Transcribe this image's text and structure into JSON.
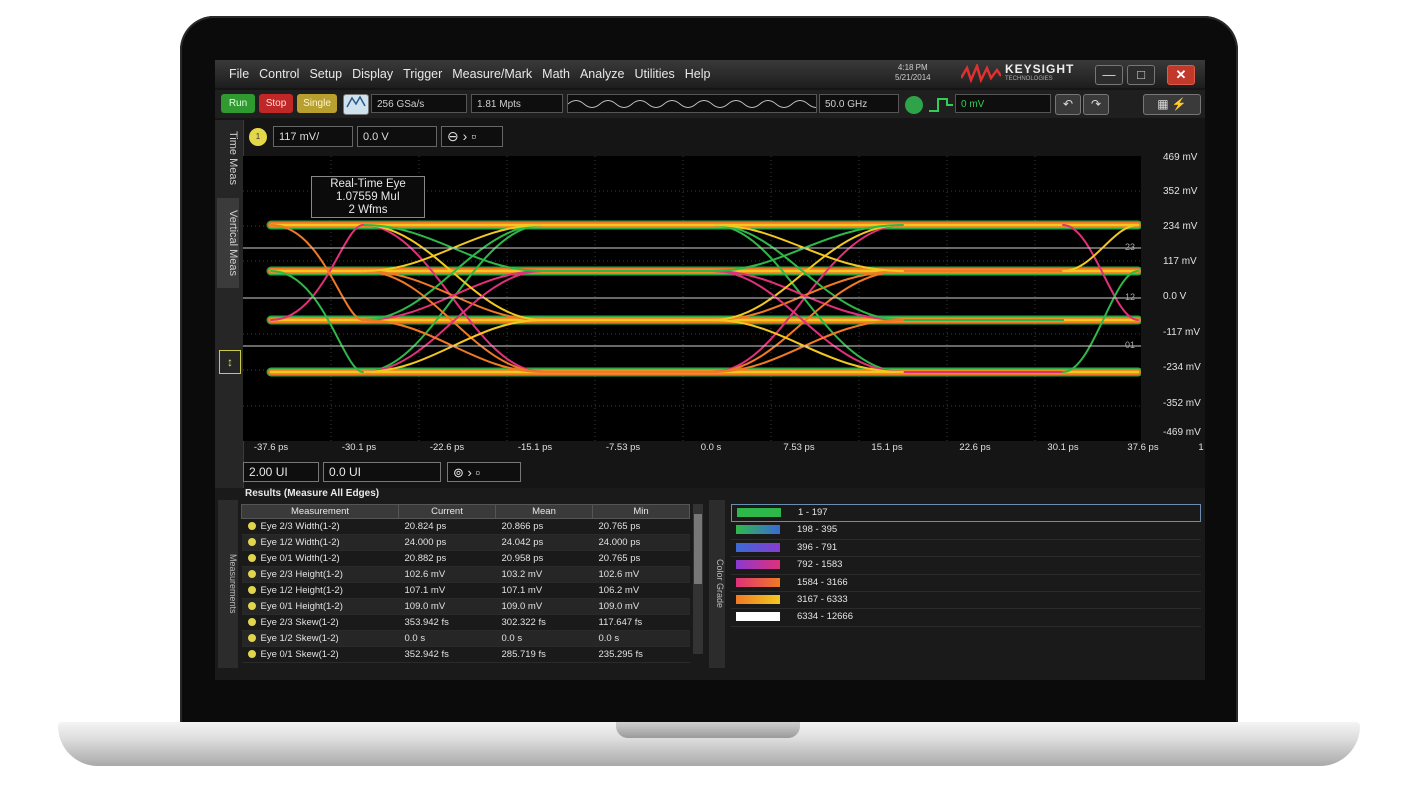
{
  "menu": [
    "File",
    "Control",
    "Setup",
    "Display",
    "Trigger",
    "Measure/Mark",
    "Math",
    "Analyze",
    "Utilities",
    "Help"
  ],
  "datetime": {
    "time": "4:18 PM",
    "date": "5/21/2014"
  },
  "brand": {
    "name": "KEYSIGHT",
    "sub": "TECHNOLOGIES"
  },
  "window_buttons": {
    "minimize": "—",
    "maximize": "□",
    "close": "✕"
  },
  "toolbar": {
    "run": "Run",
    "stop": "Stop",
    "single": "Single",
    "sample_rate": "256 GSa/s",
    "memory_depth": "1.81 Mpts",
    "bandwidth": "50.0 GHz",
    "trigger_level": "0 mV"
  },
  "vertical_tabs": {
    "time_meas": "Time Meas",
    "vertical_meas": "Vertical Meas"
  },
  "channel": {
    "badge": "1",
    "scale": "117 mV/",
    "offset": "0.0 V"
  },
  "eye_info": {
    "title": "Real-Time Eye",
    "ui": "1.07559 MuI",
    "waveforms": "2 Wfms"
  },
  "y_axis_labels": [
    "469 mV",
    "352 mV",
    "234 mV",
    "117 mV",
    "0.0 V",
    "-117 mV",
    "-234 mV",
    "-352 mV",
    "-469 mV"
  ],
  "x_axis_labels": [
    "-37.6 ps",
    "-30.1 ps",
    "-22.6 ps",
    "-15.1 ps",
    "-7.53 ps",
    "0.0 s",
    "7.53 ps",
    "15.1 ps",
    "22.6 ps",
    "30.1 ps",
    "37.6 ps"
  ],
  "x_axis_end_mark": "1",
  "level_markers": [
    "23",
    "12",
    "01"
  ],
  "time_controls": {
    "scale": "2.00 UI",
    "position": "0.0 UI"
  },
  "results": {
    "title": "Results (Measure All Edges)",
    "side_tab": "Measurements",
    "columns": [
      "Measurement",
      "Current",
      "Mean",
      "Min"
    ],
    "rows": [
      [
        "Eye 2/3 Width(1-2)",
        "20.824 ps",
        "20.866 ps",
        "20.765 ps"
      ],
      [
        "Eye 1/2 Width(1-2)",
        "24.000 ps",
        "24.042 ps",
        "24.000 ps"
      ],
      [
        "Eye 0/1 Width(1-2)",
        "20.882 ps",
        "20.958 ps",
        "20.765 ps"
      ],
      [
        "Eye 2/3 Height(1-2)",
        "102.6 mV",
        "103.2 mV",
        "102.6 mV"
      ],
      [
        "Eye 1/2 Height(1-2)",
        "107.1 mV",
        "107.1 mV",
        "106.2 mV"
      ],
      [
        "Eye 0/1 Height(1-2)",
        "109.0 mV",
        "109.0 mV",
        "109.0 mV"
      ],
      [
        "Eye 2/3 Skew(1-2)",
        "353.942 fs",
        "302.322 fs",
        "117.647 fs"
      ],
      [
        "Eye 1/2 Skew(1-2)",
        "0.0 s",
        "0.0 s",
        "0.0 s"
      ],
      [
        "Eye 0/1 Skew(1-2)",
        "352.942 fs",
        "285.719 fs",
        "235.295 fs"
      ]
    ]
  },
  "color_grade": {
    "tab": "Color Grade",
    "entries": [
      {
        "label": "1 - 197",
        "color": "#2fb84a"
      },
      {
        "label": "198 - 395",
        "color": "#3a6ad8"
      },
      {
        "label": "396 - 791",
        "color": "#8a3ad0"
      },
      {
        "label": "792 - 1583",
        "color": "#e0307a"
      },
      {
        "label": "1584 - 3166",
        "color": "#f07a24"
      },
      {
        "label": "3167 - 6333",
        "color": "#f2c81e"
      },
      {
        "label": "6334 - 12666",
        "color": "#ffffff"
      }
    ]
  },
  "colors": {
    "trace_green": "#2fb84a",
    "trace_red": "#e0307a",
    "trace_orange": "#f07a24",
    "trace_yellow": "#f2c81e",
    "accent_channel": "#e4d84a"
  }
}
